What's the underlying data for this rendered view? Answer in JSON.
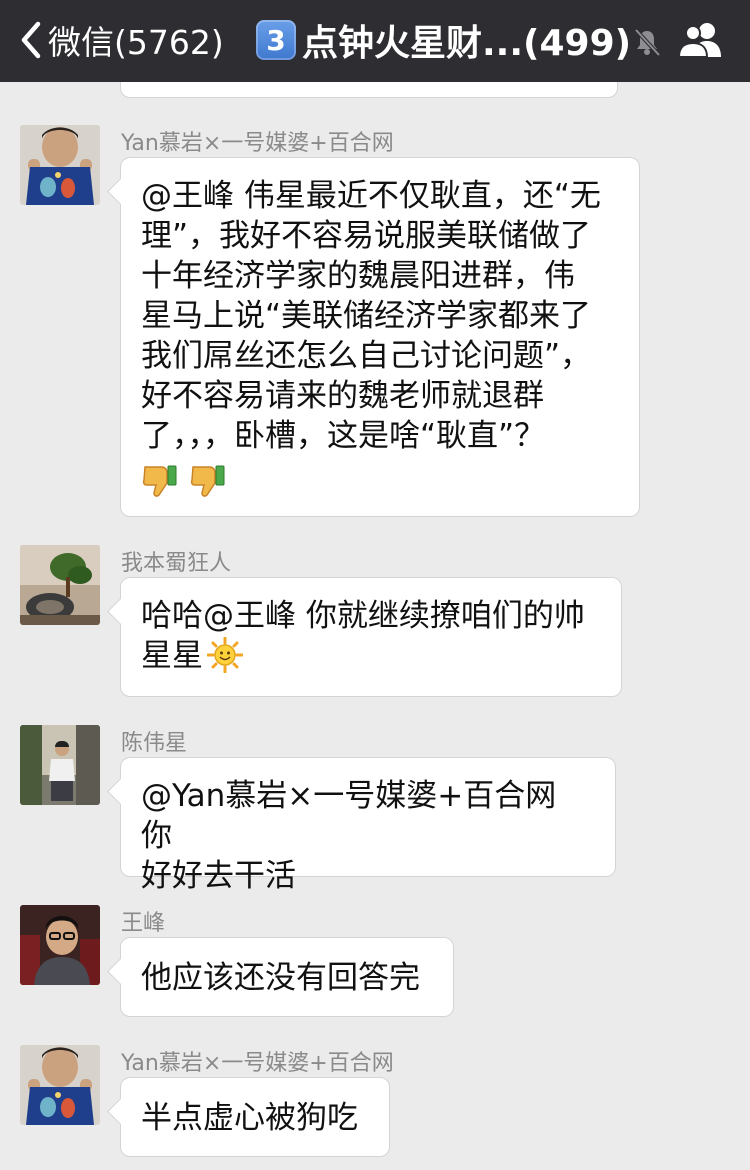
{
  "header": {
    "back_label": "微信(5762)",
    "group_badge": "3",
    "group_title": "点钟火星财...(499)",
    "icons": [
      "back-chevron-icon",
      "mute-bell-icon",
      "group-members-icon"
    ]
  },
  "messages": [
    {
      "sender": "Yan慕岩×一号媒婆+百合网",
      "text": "@王峰 伟星最近不仅耿直，还“无\n理”，我好不容易说服美联储做了\n十年经济学家的魏晨阳进群，伟\n星马上说“美联储经济学家都来了\n我们屌丝还怎么自己讨论问题”，\n好不容易请来的魏老师就退群\n了，，，卧槽，这是啥“耿直”？",
      "emojis": [
        "thumbs-down-icon",
        "thumbs-down-icon"
      ]
    },
    {
      "sender": "我本蜀狂人",
      "text": "哈哈@王峰 你就继续撩咱们的帅\n星星",
      "emojis": [
        "sun-icon"
      ]
    },
    {
      "sender": "陈伟星",
      "text": "@Yan慕岩×一号媒婆+百合网 你\n好好去干活"
    },
    {
      "sender": "王峰",
      "text": "他应该还没有回答完"
    },
    {
      "sender": "Yan慕岩×一号媒婆+百合网",
      "text": "半点虚心被狗吃"
    }
  ],
  "colors": {
    "topbar": "#2e2d32",
    "chat_background": "#ebebeb",
    "bubble": "#ffffff",
    "sender_name": "#8a8a8a"
  }
}
